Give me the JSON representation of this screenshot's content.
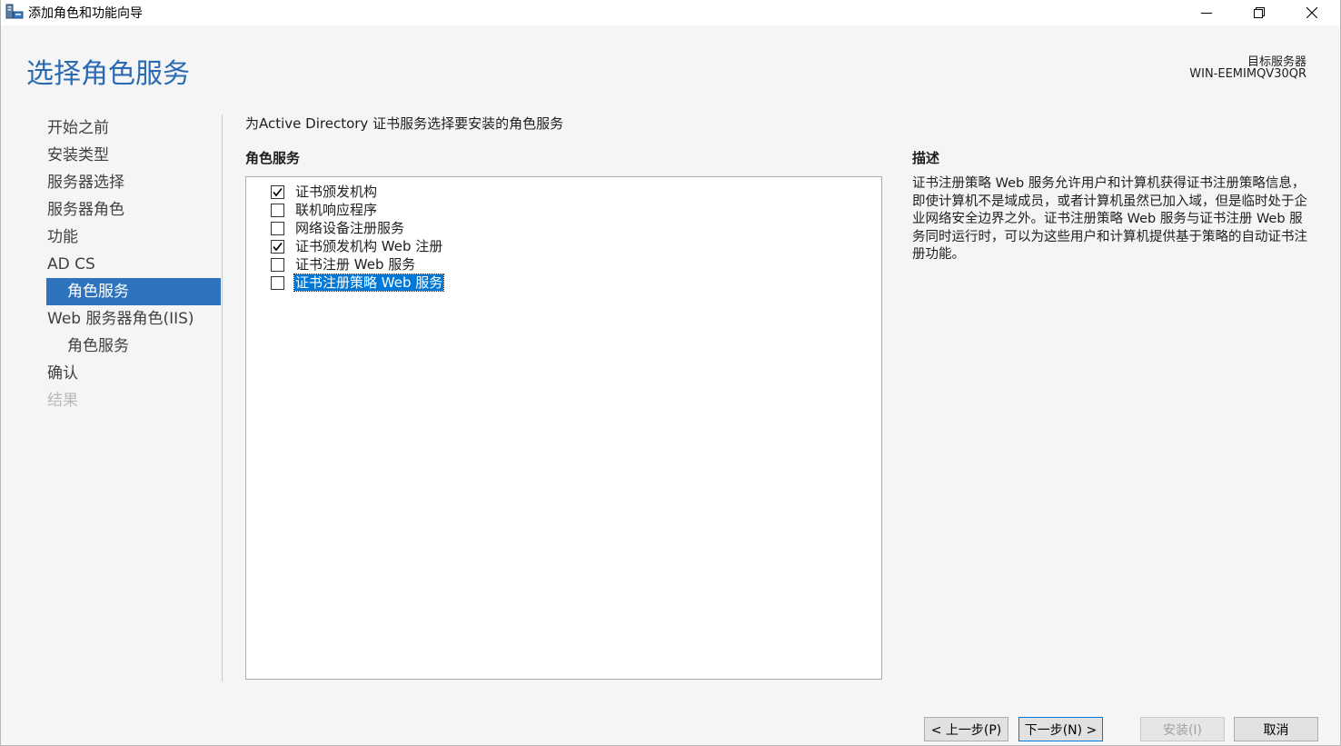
{
  "window": {
    "title": "添加角色和功能向导",
    "icon": "server-manager-icon",
    "controls": [
      "minimize-icon",
      "maximize-icon",
      "close-icon"
    ]
  },
  "header": {
    "page_title": "选择角色服务",
    "target_label": "目标服务器",
    "target_value": "WIN-EEMIMQV30QR"
  },
  "nav": {
    "items": [
      {
        "label": "开始之前",
        "state": "normal",
        "indent": false
      },
      {
        "label": "安装类型",
        "state": "normal",
        "indent": false
      },
      {
        "label": "服务器选择",
        "state": "normal",
        "indent": false
      },
      {
        "label": "服务器角色",
        "state": "normal",
        "indent": false
      },
      {
        "label": "功能",
        "state": "normal",
        "indent": false
      },
      {
        "label": "AD CS",
        "state": "normal",
        "indent": false
      },
      {
        "label": "角色服务",
        "state": "active",
        "indent": true
      },
      {
        "label": "Web 服务器角色(IIS)",
        "state": "normal",
        "indent": false
      },
      {
        "label": "角色服务",
        "state": "normal",
        "indent": true
      },
      {
        "label": "确认",
        "state": "normal",
        "indent": false
      },
      {
        "label": "结果",
        "state": "disabled",
        "indent": false
      }
    ]
  },
  "main": {
    "instruction": "为Active Directory 证书服务选择要安装的角色服务",
    "section_title": "角色服务",
    "roles": [
      {
        "label": "证书颁发机构",
        "checked": true,
        "selected": false
      },
      {
        "label": "联机响应程序",
        "checked": false,
        "selected": false
      },
      {
        "label": "网络设备注册服务",
        "checked": false,
        "selected": false
      },
      {
        "label": "证书颁发机构 Web 注册",
        "checked": true,
        "selected": false
      },
      {
        "label": "证书注册 Web 服务",
        "checked": false,
        "selected": false
      },
      {
        "label": "证书注册策略 Web 服务",
        "checked": false,
        "selected": true
      }
    ]
  },
  "description": {
    "title": "描述",
    "text": "证书注册策略 Web 服务允许用户和计算机获得证书注册策略信息，即使计算机不是域成员，或者计算机虽然已加入域，但是临时处于企业网络安全边界之外。证书注册策略 Web 服务与证书注册 Web 服务同时运行时，可以为这些用户和计算机提供基于策略的自动证书注册功能。"
  },
  "buttons": {
    "prev": "< 上一步(P)",
    "next": "下一步(N) >",
    "install": "安装(I)",
    "cancel": "取消"
  },
  "colors": {
    "accent": "#2a6ab2",
    "nav_active_bg": "#2d73bd",
    "selection_bg": "#0078d7"
  }
}
